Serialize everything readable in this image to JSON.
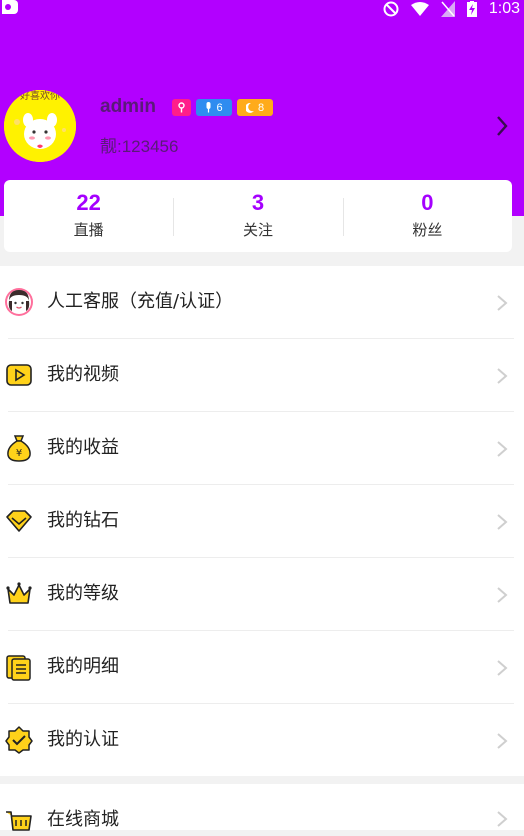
{
  "status_bar": {
    "time": "1:03"
  },
  "profile": {
    "avatar_caption": "好喜欢你",
    "username": "admin",
    "badges": {
      "anchor_level": "6",
      "wealth_level": "8"
    },
    "user_id": "靓:123456"
  },
  "stats": [
    {
      "value": "22",
      "label": "直播"
    },
    {
      "value": "3",
      "label": "关注"
    },
    {
      "value": "0",
      "label": "粉丝"
    }
  ],
  "menu": [
    {
      "label": "人工客服（充值/认证）",
      "icon": "customer-service-icon"
    },
    {
      "label": "我的视频",
      "icon": "video-icon"
    },
    {
      "label": "我的收益",
      "icon": "money-bag-icon"
    },
    {
      "label": "我的钻石",
      "icon": "diamond-icon"
    },
    {
      "label": "我的等级",
      "icon": "crown-icon"
    },
    {
      "label": "我的明细",
      "icon": "details-icon"
    },
    {
      "label": "我的认证",
      "icon": "verify-icon"
    }
  ],
  "menu2": [
    {
      "label": "在线商城",
      "icon": "shop-cart-icon"
    }
  ],
  "colors": {
    "header": "#b200ff",
    "accent": "#a500ff",
    "icon_yellow": "#ffd21a"
  }
}
